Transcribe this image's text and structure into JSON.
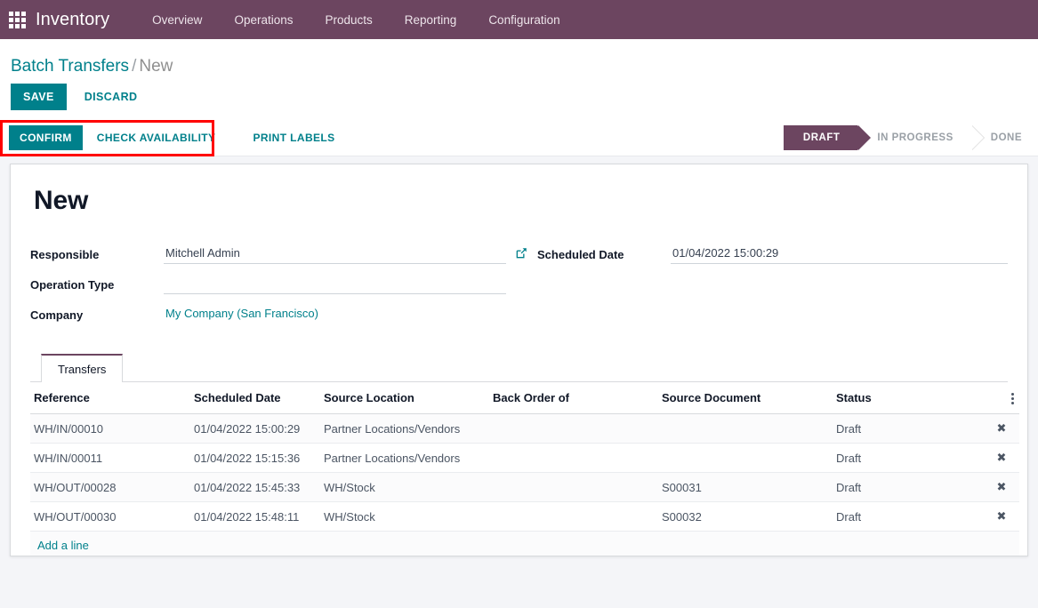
{
  "navbar": {
    "apps_icon": "apps-grid-icon",
    "brand": "Inventory",
    "menu": [
      {
        "label": "Overview"
      },
      {
        "label": "Operations"
      },
      {
        "label": "Products"
      },
      {
        "label": "Reporting"
      },
      {
        "label": "Configuration"
      }
    ]
  },
  "breadcrumb": {
    "root": "Batch Transfers",
    "separator": "/",
    "current": "New"
  },
  "control_panel": {
    "save_label": "SAVE",
    "discard_label": "DISCARD"
  },
  "statusbar": {
    "buttons": [
      {
        "label": "CONFIRM",
        "style": "primary"
      },
      {
        "label": "CHECK AVAILABILITY",
        "style": "plain"
      },
      {
        "label": "PRINT LABELS",
        "style": "plain"
      }
    ],
    "highlight_color": "#FF0000",
    "pipeline": [
      {
        "label": "DRAFT",
        "active": true
      },
      {
        "label": "IN PROGRESS",
        "active": false
      },
      {
        "label": "DONE",
        "active": false
      }
    ]
  },
  "form": {
    "title": "New",
    "left": [
      {
        "label": "Responsible",
        "value": "Mitchell Admin",
        "type": "many2one",
        "has_caret": true,
        "has_ext_link": true
      },
      {
        "label": "Operation Type",
        "value": "",
        "type": "many2one",
        "has_caret": true,
        "has_ext_link": false
      },
      {
        "label": "Company",
        "value": "My Company (San Francisco)",
        "type": "link",
        "has_caret": false,
        "has_ext_link": false
      }
    ],
    "right": [
      {
        "label": "Scheduled Date",
        "value": "01/04/2022 15:00:29",
        "type": "datetime",
        "has_caret": true
      }
    ]
  },
  "notebook": {
    "tabs": [
      {
        "label": "Transfers",
        "active": true
      }
    ]
  },
  "table": {
    "columns": [
      "Reference",
      "Scheduled Date",
      "Source Location",
      "Back Order of",
      "Source Document",
      "Status"
    ],
    "optional_columns_icon": "vertical-dots-icon",
    "rows": [
      {
        "reference": "WH/IN/00010",
        "scheduled_date": "01/04/2022 15:00:29",
        "source_location": "Partner Locations/Vendors",
        "back_order_of": "",
        "source_document": "",
        "status": "Draft",
        "delete_icon": "✖"
      },
      {
        "reference": "WH/IN/00011",
        "scheduled_date": "01/04/2022 15:15:36",
        "source_location": "Partner Locations/Vendors",
        "back_order_of": "",
        "source_document": "",
        "status": "Draft",
        "delete_icon": "✖"
      },
      {
        "reference": "WH/OUT/00028",
        "scheduled_date": "01/04/2022 15:45:33",
        "source_location": "WH/Stock",
        "back_order_of": "",
        "source_document": "S00031",
        "status": "Draft",
        "delete_icon": "✖"
      },
      {
        "reference": "WH/OUT/00030",
        "scheduled_date": "01/04/2022 15:48:11",
        "source_location": "WH/Stock",
        "back_order_of": "",
        "source_document": "S00032",
        "status": "Draft",
        "delete_icon": "✖"
      }
    ],
    "add_line_label": "Add a line"
  },
  "colors": {
    "navbar": "#6C4560",
    "accent": "#00808B",
    "active_stage": "#6C4560",
    "page_bg": "#F4F5F8"
  }
}
